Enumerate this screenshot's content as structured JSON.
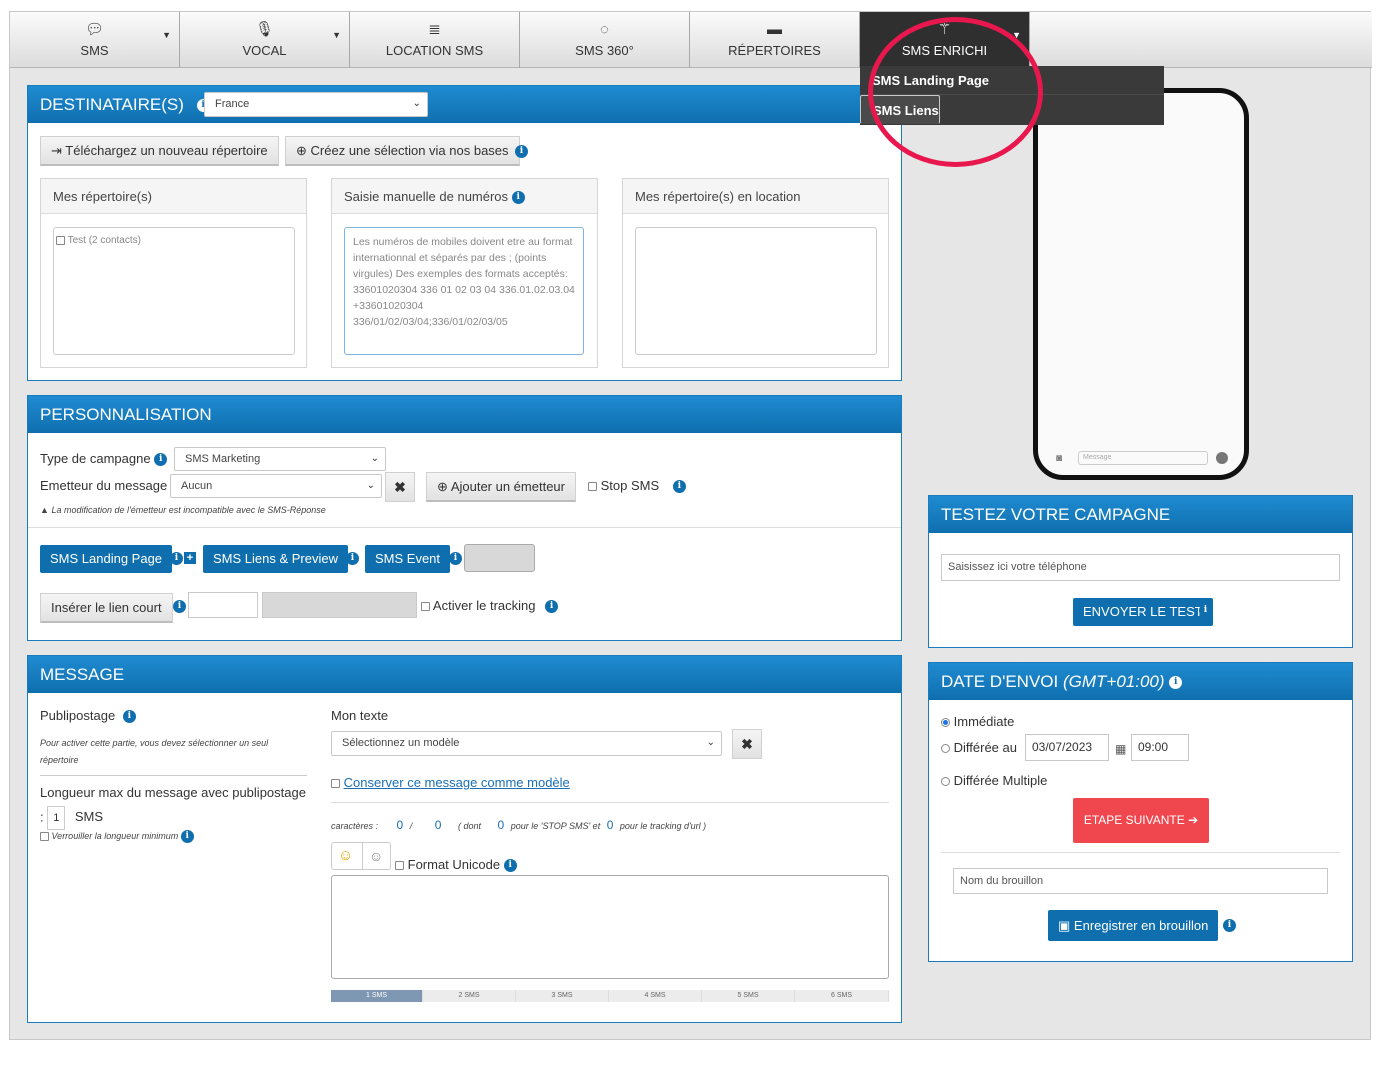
{
  "nav": {
    "items": [
      {
        "label": "SMS",
        "icon": "chat-icon"
      },
      {
        "label": "VOCAL",
        "icon": "microphone-icon"
      },
      {
        "label": "LOCATION SMS",
        "icon": "database-icon"
      },
      {
        "label": "SMS 360°",
        "icon": "circle-refresh-icon"
      },
      {
        "label": "RÉPERTOIRES",
        "icon": "folder-icon"
      },
      {
        "label": "SMS ENRICHI",
        "icon": "magic-wand-icon"
      }
    ],
    "dropdown": [
      "SMS Landing Page",
      "SMS Liens"
    ]
  },
  "destinataires": {
    "title": "DESTINATAIRE(S)",
    "country": "France",
    "upload_btn": "Téléchargez un nouveau répertoire",
    "create_btn": "Créez une sélection via nos bases",
    "box1_title": "Mes répertoire(s)",
    "box1_item": "Test (2 contacts)",
    "box2_title": "Saisie manuelle de numéros",
    "box2_placeholder": "Les numéros de mobiles doivent etre au format internationnal et séparés par des ; (points virgules) Des exemples des formats acceptés: 33601020304   336 01 02 03 04 336.01.02.03.04   +33601020304 336/01/02/03/04;336/01/02/03/05",
    "box3_title": "Mes répertoire(s) en location"
  },
  "perso": {
    "title": "PERSONNALISATION",
    "type_label": "Type de campagne",
    "type_value": "SMS Marketing",
    "emetteur_label": "Emetteur du message",
    "emetteur_value": "Aucun",
    "add_emetteur": "Ajouter un émetteur",
    "stop_sms": "Stop SMS",
    "warning": "La modification de l'émetteur est incompatible avec le SMS-Réponse",
    "btn_landing": "SMS Landing Page",
    "btn_liens": "SMS Liens & Preview",
    "btn_event": "SMS Event",
    "btn_lien_court": "Insérer le lien court",
    "tracking": "Activer le tracking"
  },
  "message": {
    "title": "MESSAGE",
    "publipostage": "Publipostage",
    "publi_note": "Pour activer cette partie, vous devez sélectionner un seul répertoire",
    "longueur": "Longueur max du message avec publipostage",
    "longueur_prefix": ":",
    "longueur_value": "1",
    "longueur_unit": "SMS",
    "verrouiller": "Verrouiller la longueur minimum",
    "mon_texte": "Mon texte",
    "modele": "Sélectionnez un modèle",
    "conserver": "Conserver ce message comme modèle",
    "caracteres": "caractères :",
    "count1": "0",
    "slash": "/",
    "count2": "0",
    "dont": "( dont",
    "count3": "0",
    "stop_txt": "pour le 'STOP SMS' et",
    "count4": "0",
    "tracking_txt": "pour le tracking d'url )",
    "unicode": "Format Unicode",
    "segments": [
      "1 SMS",
      "2 SMS",
      "3 SMS",
      "4 SMS",
      "5 SMS",
      "6 SMS"
    ]
  },
  "test": {
    "title": "TESTEZ VOTRE CAMPAGNE",
    "placeholder": "Saisissez ici votre téléphone",
    "button": "ENVOYER LE TEST"
  },
  "date": {
    "title": "DATE D'ENVOI",
    "tz": "(GMT+01:00)",
    "immediate": "Immédiate",
    "differee": "Différée au",
    "date_value": "03/07/2023",
    "time_value": "09:00",
    "multiple": "Différée Multiple",
    "next": "ETAPE SUIVANTE",
    "draft_placeholder": "Nom du brouillon",
    "save": "Enregistrer en brouillon"
  },
  "phone": {
    "message_placeholder": "Message"
  },
  "colors": {
    "accent": "#0f6fae",
    "highlight": "#e8184f",
    "next": "#f0474f"
  }
}
